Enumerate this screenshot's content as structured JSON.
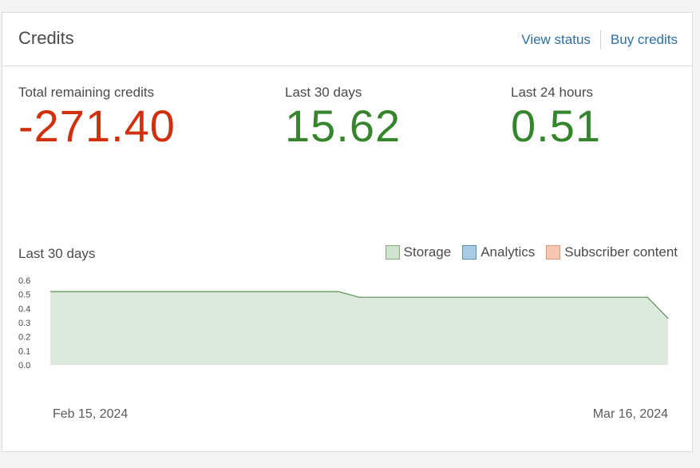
{
  "card": {
    "title": "Credits",
    "actions": {
      "view_status": "View status",
      "buy_credits": "Buy credits"
    }
  },
  "stats": {
    "total": {
      "label": "Total remaining credits",
      "value": "-271.40",
      "color": "#d0300d"
    },
    "month": {
      "label": "Last 30 days",
      "value": "15.62",
      "color": "#35852d"
    },
    "day": {
      "label": "Last 24 hours",
      "value": "0.51",
      "color": "#35852d"
    }
  },
  "chart_data": {
    "type": "area",
    "title": "Last 30 days",
    "x_start_label": "Feb 15, 2024",
    "x_end_label": "Mar 16, 2024",
    "yticks": [
      "0.6",
      "0.5",
      "0.4",
      "0.3",
      "0.2",
      "0.1",
      "0.0"
    ],
    "ylim": [
      0,
      0.6
    ],
    "series": [
      {
        "name": "Storage",
        "color": "#cfe3cf",
        "line_color": "#5a8f55",
        "values": [
          0.52,
          0.52,
          0.52,
          0.52,
          0.52,
          0.52,
          0.52,
          0.52,
          0.52,
          0.52,
          0.52,
          0.52,
          0.52,
          0.52,
          0.52,
          0.48,
          0.48,
          0.48,
          0.48,
          0.48,
          0.48,
          0.48,
          0.48,
          0.48,
          0.48,
          0.48,
          0.48,
          0.48,
          0.48,
          0.48,
          0.33
        ]
      },
      {
        "name": "Analytics",
        "color": "#a9cde6",
        "values": []
      },
      {
        "name": "Subscriber content",
        "color": "#f7c6b0",
        "values": []
      }
    ],
    "grid": false
  }
}
